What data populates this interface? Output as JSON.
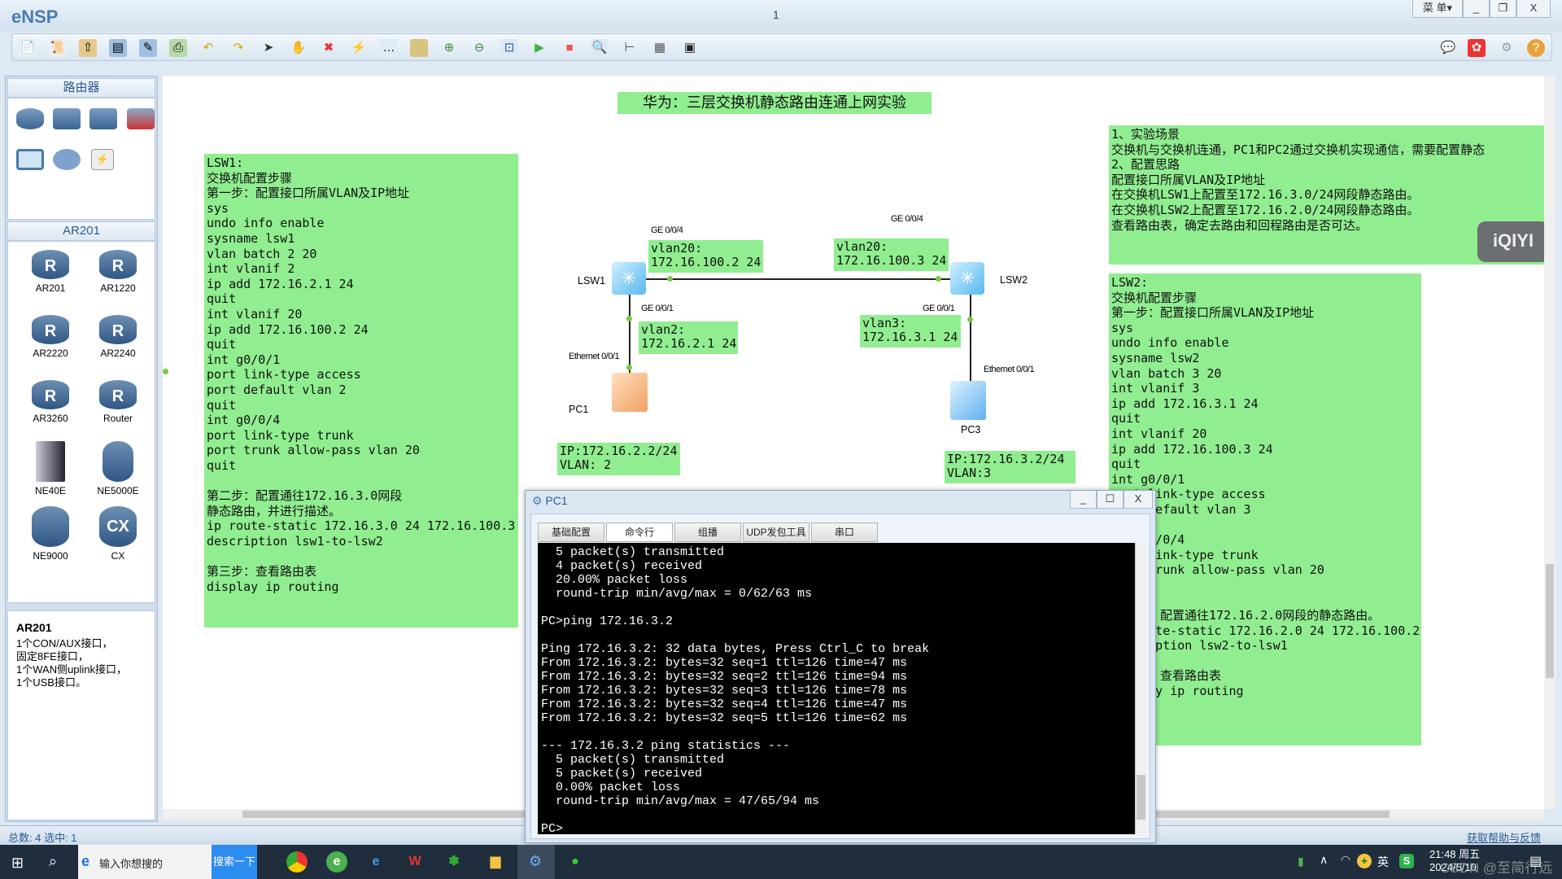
{
  "app": {
    "name": "eNSP",
    "window_title": "1",
    "menu_label": "菜 单▾",
    "minimize": "_",
    "restore": "❐",
    "close": "X"
  },
  "toolbar": {
    "icons": [
      "new-topology",
      "new-lab",
      "open",
      "save",
      "save-as",
      "print",
      "undo",
      "redo",
      "select",
      "pan",
      "delete",
      "delete-link",
      "text",
      "shape",
      "zoom-in",
      "zoom-out",
      "fit",
      "start",
      "stop",
      "capture",
      "topology",
      "grid",
      "console"
    ],
    "right_icons": [
      "chat",
      "huawei",
      "settings",
      "help"
    ]
  },
  "left_panel": {
    "category_header": "路由器",
    "device_header": "AR201",
    "devices": [
      "AR201",
      "AR1220",
      "AR2220",
      "AR2240",
      "AR3260",
      "Router",
      "NE40E",
      "NE5000E",
      "NE9000",
      "CX"
    ],
    "info_title": "AR201",
    "info_lines": [
      "1个CON/AUX接口，",
      "固定8FE接口，",
      "1个WAN侧uplink接口，",
      "1个USB接口。"
    ]
  },
  "canvas": {
    "title": "华为：三层交换机静态路由连通上网实验",
    "lsw1_notes": "LSW1:\n交换机配置步骤\n第一步：配置接口所属VLAN及IP地址\nsys\nundo info enable\nsysname lsw1\nvlan batch 2 20\nint vlanif 2\nip add 172.16.2.1 24\nquit\nint vlanif 20\nip add 172.16.100.2 24\nquit\nint g0/0/1\nport link-type access\nport default vlan 2\nquit\nint g0/0/4\nport link-type trunk\nport trunk allow-pass vlan 20\nquit\n\n第二步：配置通往172.16.3.0网段\n静态路由，并进行描述。\nip route-static 172.16.3.0 24 172.16.100.3\ndescription lsw1-to-lsw2\n\n第三步：查看路由表\ndisplay ip routing",
    "scenario_notes": "1、实验场景\n交换机与交换机连通，PC1和PC2通过交换机实现通信，需要配置静态\n2、配置思路\n配置接口所属VLAN及IP地址\n在交换机LSW1上配置至172.16.3.0/24网段静态路由。\n在交换机LSW2上配置至172.16.2.0/24网段静态路由。\n查看路由表，确定去路由和回程路由是否可达。",
    "lsw2_notes": "LSW2:\n交换机配置步骤\n第一步：配置接口所属VLAN及IP地址\nsys\nundo info enable\nsysname lsw2\nvlan batch 3 20\nint vlanif 3\nip add 172.16.3.1 24\nquit\nint vlanif 20\nip add 172.16.100.3 24\nquit\nint g0/0/1\nport link-type access\nport default vlan 3\nquit\nint g0/0/4\nport link-type trunk\nport trunk allow-pass vlan 20\nquit\n\n第二步：配置通往172.16.2.0网段的静态路由。\nip route-static 172.16.2.0 24 172.16.100.2\ndescription lsw2-to-lsw1\n\n第三步：查看路由表\ndisplay ip routing",
    "watermark": "iQIYI",
    "topology": {
      "lsw1": "LSW1",
      "lsw2": "LSW2",
      "pc1": "PC1",
      "pc3": "PC3",
      "lsw1_ge004": "GE 0/0/4",
      "lsw2_ge004": "GE 0/0/4",
      "lsw1_ge001": "GE 0/0/1",
      "lsw2_ge001": "GE 0/0/1",
      "pc1_eth": "Ethernet 0/0/1",
      "pc3_eth": "Ethernet 0/0/1",
      "lsw1_vlan20": "vlan20:\n172.16.100.2 24",
      "lsw2_vlan20": "vlan20:\n172.16.100.3 24",
      "lsw1_vlan2": "vlan2:\n172.16.2.1 24",
      "lsw2_vlan3": "vlan3:\n172.16.3.1 24",
      "pc1_ip": "IP:172.16.2.2/24\nVLAN: 2",
      "pc3_ip": "IP:172.16.3.2/24\nVLAN:3"
    }
  },
  "pc_window": {
    "title": "PC1",
    "tabs": [
      "基础配置",
      "命令行",
      "组播",
      "UDP发包工具",
      "串口"
    ],
    "active_tab": "命令行",
    "terminal": "  5 packet(s) transmitted\n  4 packet(s) received\n  20.00% packet loss\n  round-trip min/avg/max = 0/62/63 ms\n\nPC>ping 172.16.3.2\n\nPing 172.16.3.2: 32 data bytes, Press Ctrl_C to break\nFrom 172.16.3.2: bytes=32 seq=1 ttl=126 time=47 ms\nFrom 172.16.3.2: bytes=32 seq=2 ttl=126 time=94 ms\nFrom 172.16.3.2: bytes=32 seq=3 ttl=126 time=78 ms\nFrom 172.16.3.2: bytes=32 seq=4 ttl=126 time=47 ms\nFrom 172.16.3.2: bytes=32 seq=5 ttl=126 time=62 ms\n\n--- 172.16.3.2 ping statistics ---\n  5 packet(s) transmitted\n  5 packet(s) received\n  0.00% packet loss\n  round-trip min/avg/max = 47/65/94 ms\n\nPC>"
  },
  "statusbar": {
    "left": "总数: 4 选中: 1",
    "help_link": "获取帮助与反馈"
  },
  "taskbar": {
    "search_placeholder": "输入你想搜的",
    "search_button": "搜索一下",
    "ime": "英",
    "time": "21:48 周五",
    "date": "2024/5/10",
    "watermark": "CSDN @至简行远"
  },
  "colors": {
    "note_bg": "#90ee90",
    "terminal_bg": "#000000",
    "link_dot": "#7ac943",
    "accent": "#2b5c8f"
  }
}
